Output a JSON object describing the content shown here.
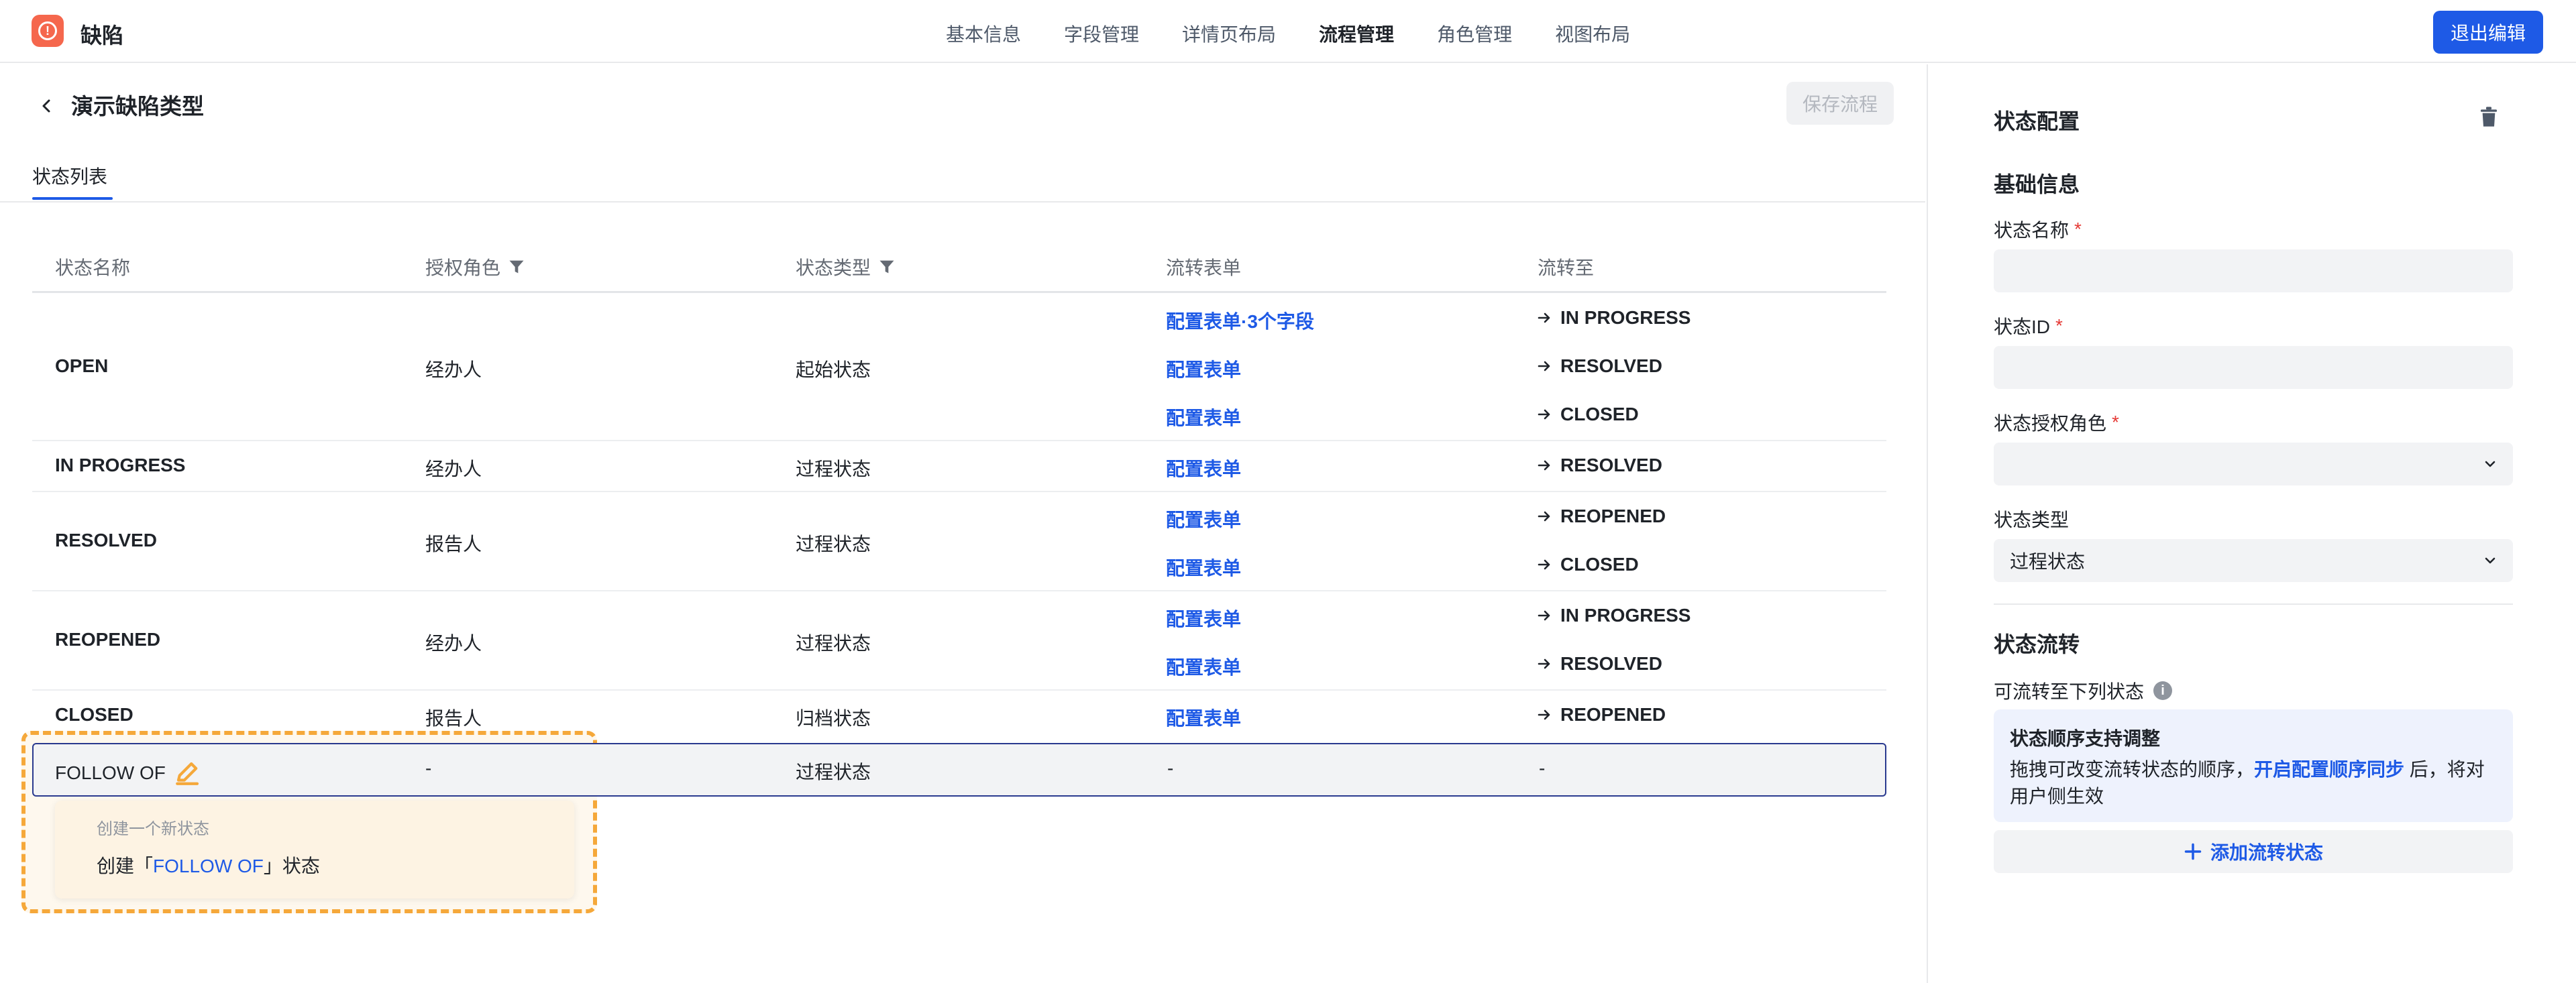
{
  "header": {
    "app_title": "缺陷",
    "tabs": [
      "基本信息",
      "字段管理",
      "详情页布局",
      "流程管理",
      "角色管理",
      "视图布局"
    ],
    "active_tab": "流程管理",
    "exit_button": "退出编辑"
  },
  "main": {
    "title": "演示缺陷类型",
    "save_button": "保存流程",
    "sub_tab": "状态列表",
    "columns": [
      "状态名称",
      "授权角色",
      "状态类型",
      "流转表单",
      "流转至"
    ],
    "rows": [
      {
        "name": "OPEN",
        "role": "经办人",
        "type": "起始状态",
        "forms": [
          "配置表单·3个字段",
          "配置表单",
          "配置表单"
        ],
        "targets": [
          "IN PROGRESS",
          "RESOLVED",
          "CLOSED"
        ]
      },
      {
        "name": "IN PROGRESS",
        "role": "经办人",
        "type": "过程状态",
        "forms": [
          "配置表单"
        ],
        "targets": [
          "RESOLVED"
        ]
      },
      {
        "name": "RESOLVED",
        "role": "报告人",
        "type": "过程状态",
        "forms": [
          "配置表单",
          "配置表单"
        ],
        "targets": [
          "REOPENED",
          "CLOSED"
        ]
      },
      {
        "name": "REOPENED",
        "role": "经办人",
        "type": "过程状态",
        "forms": [
          "配置表单",
          "配置表单"
        ],
        "targets": [
          "IN PROGRESS",
          "RESOLVED"
        ]
      },
      {
        "name": "CLOSED",
        "role": "报告人",
        "type": "归档状态",
        "forms": [
          "配置表单"
        ],
        "targets": [
          "REOPENED"
        ]
      }
    ],
    "new_row": {
      "name": "FOLLOW OF",
      "role": "-",
      "type": "过程状态",
      "form": "-",
      "target": "-"
    },
    "suggestion": {
      "hint": "创建一个新状态",
      "prefix": "创建「",
      "value": "FOLLOW OF",
      "suffix": "」状态"
    }
  },
  "panel": {
    "title": "状态配置",
    "section_basic": "基础信息",
    "name_label": "状态名称",
    "id_label": "状态ID",
    "role_label": "状态授权角色",
    "type_label": "状态类型",
    "type_value": "过程状态",
    "required_mark": "*",
    "section_flow": "状态流转",
    "flow_label": "可流转至下列状态",
    "tip_title": "状态顺序支持调整",
    "tip_text_before": "拖拽可改变流转状态的顺序，",
    "tip_link": "开启配置顺序同步",
    "tip_text_after": " 后，将对用户侧生效",
    "add_button": "添加流转状态"
  },
  "colors": {
    "accent": "#1e5ae6",
    "logo": "#f5674d",
    "highlight": "#f5a83a",
    "required": "#e53935"
  },
  "icons": [
    "bug-logo-icon",
    "back-arrow-icon",
    "filter-icon",
    "arrow-right-icon",
    "pencil-icon",
    "trash-icon",
    "chevron-down-icon",
    "info-icon",
    "plus-icon"
  ]
}
